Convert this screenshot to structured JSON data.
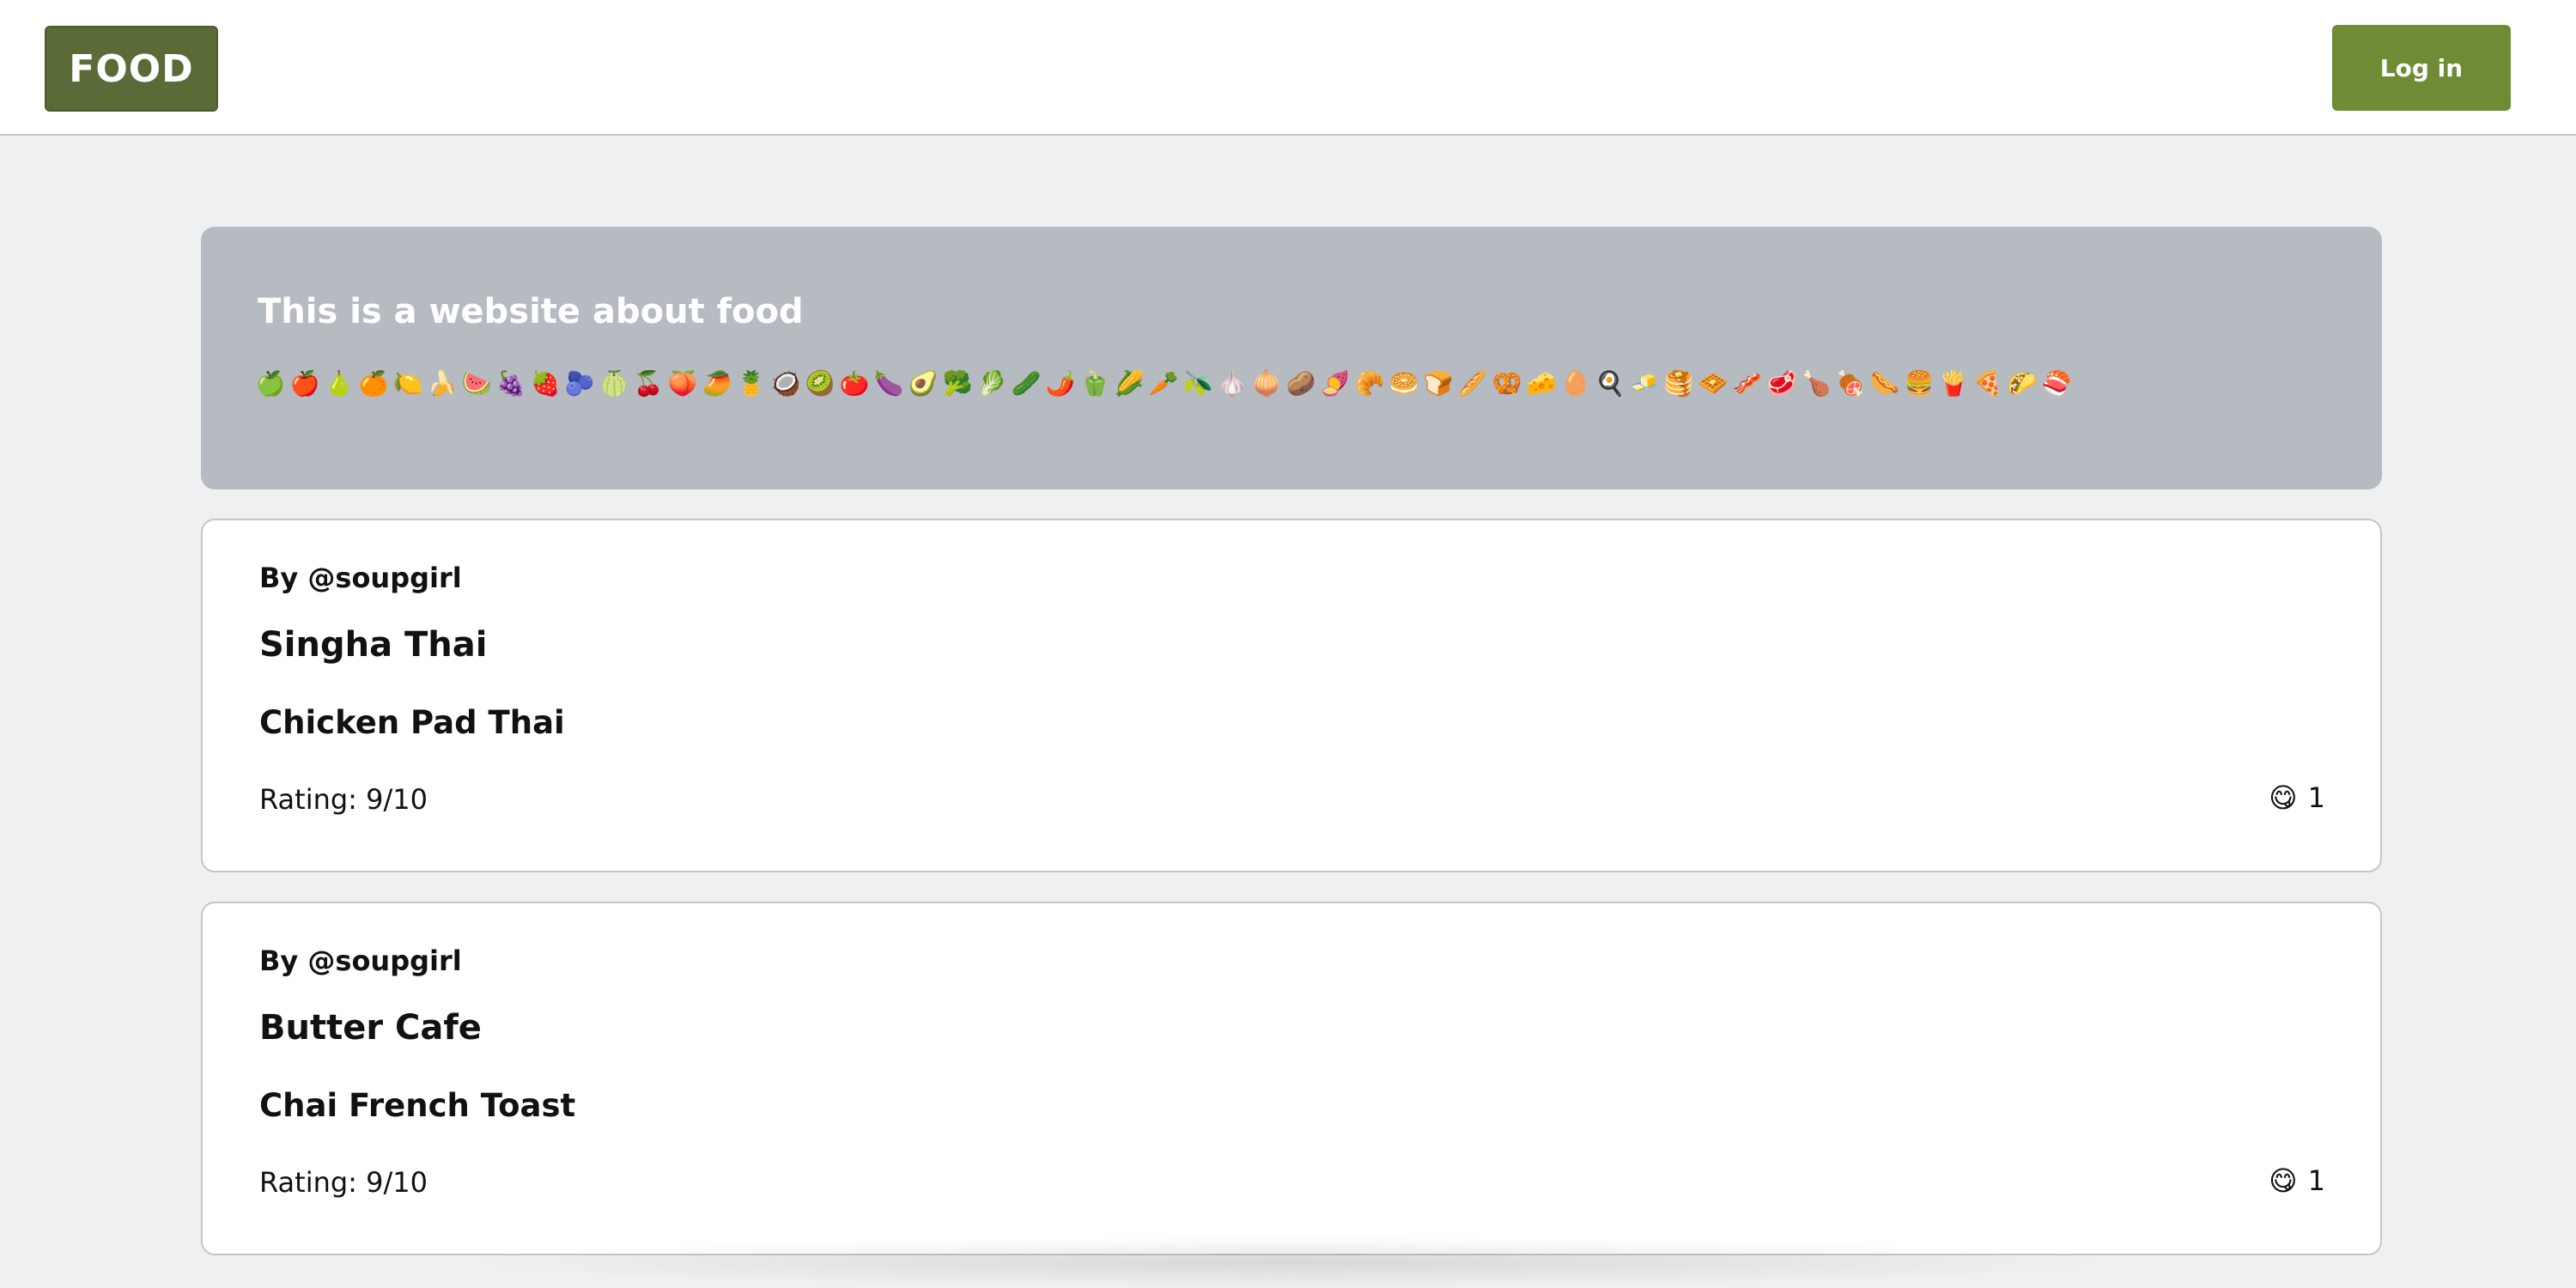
{
  "navbar": {
    "logo": "FOOD",
    "login_label": "Log in"
  },
  "hero": {
    "title": "This is a website about food",
    "emojis": [
      "🍏",
      "🍎",
      "🍐",
      "🍊",
      "🍋",
      "🍌",
      "🍉",
      "🍇",
      "🍓",
      "🫐",
      "🍈",
      "🍒",
      "🍑",
      "🥭",
      "🍍",
      "🥥",
      "🥝",
      "🍅",
      "🍆",
      "🥑",
      "🥦",
      "🥬",
      "🥒",
      "🌶️",
      "🫑",
      "🌽",
      "🥕",
      "🫒",
      "🧄",
      "🧅",
      "🥔",
      "🍠",
      "🥐",
      "🥯",
      "🍞",
      "🥖",
      "🥨",
      "🧀",
      "🥚",
      "🍳",
      "🧈",
      "🥞",
      "🧇",
      "🥓",
      "🥩",
      "🍗",
      "🍖",
      "🌭",
      "🍔",
      "🍟",
      "🍕",
      "🌮",
      "🍣"
    ]
  },
  "posts": [
    {
      "author": "By @soupgirl",
      "restaurant": "Singha Thai",
      "dish": "Chicken Pad Thai",
      "rating": "Rating: 9/10",
      "reaction_emoji": "😋",
      "reaction_count": "1"
    },
    {
      "author": "By @soupgirl",
      "restaurant": "Butter Cafe",
      "dish": "Chai French Toast",
      "rating": "Rating: 9/10",
      "reaction_emoji": "😋",
      "reaction_count": "1"
    }
  ]
}
